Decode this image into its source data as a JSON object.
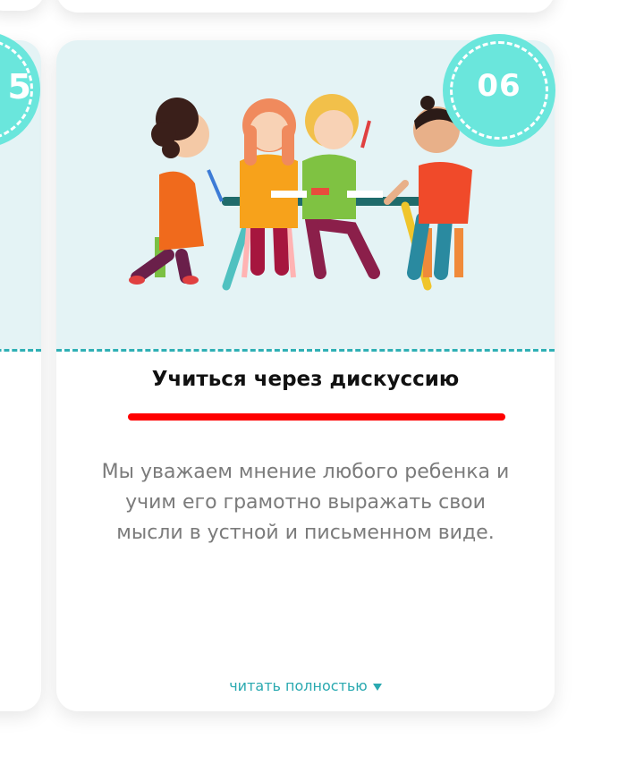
{
  "card": {
    "number": "06",
    "title": "Учиться через дискуссию",
    "description": "Мы уважаем мнение любого ребенка и учим его грамотно выражать свои мысли в устной и письменном виде.",
    "read_more": "читать полностью",
    "illustration_icon": "children-discussion-illustration"
  },
  "left_card": {
    "number": "5"
  },
  "colors": {
    "badge": "#6ae6dc",
    "image_bg": "#e4f3f5",
    "dash": "#2fb0b5",
    "underline": "#ff0000",
    "link": "#2aa9b0"
  }
}
